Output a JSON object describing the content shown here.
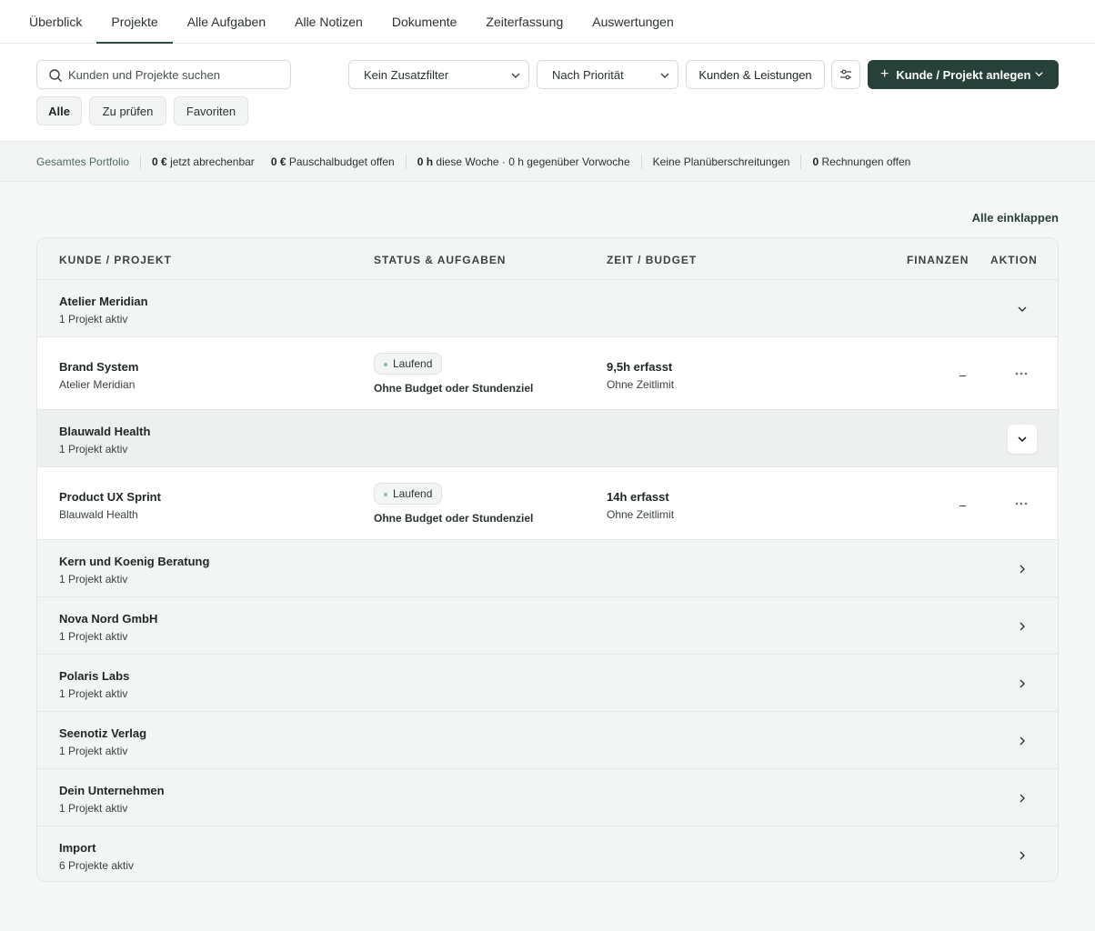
{
  "nav": {
    "tabs": [
      "Überblick",
      "Projekte",
      "Alle Aufgaben",
      "Alle Notizen",
      "Dokumente",
      "Zeiterfassung",
      "Auswertungen"
    ],
    "active": "Projekte"
  },
  "toolbar": {
    "search_placeholder": "Kunden und Projekte suchen",
    "filter_select": "Kein Zusatzfilter",
    "sort_select": "Nach Priorität",
    "clients_button": "Kunden & Leistungen",
    "create_button": "Kunde / Projekt anlegen",
    "chips": [
      "Alle",
      "Zu prüfen",
      "Favoriten"
    ],
    "active_chip": "Alle"
  },
  "summary": {
    "lead": "Gesamtes Portfolio",
    "billable_value": "0 €",
    "billable_label": "jetzt abrechenbar",
    "flat_value": "0 €",
    "flat_label": "Pauschalbudget offen",
    "week_value": "0 h",
    "week_label": "diese Woche · 0 h gegenüber Vorwoche",
    "overruns": "Keine Planüberschreitungen",
    "invoices_value": "0",
    "invoices_label": "Rechnungen offen"
  },
  "collapse_all": "Alle einklappen",
  "table": {
    "headers": {
      "client_project": "KUNDE / PROJEKT",
      "status": "STATUS & AUFGABEN",
      "time": "ZEIT / BUDGET",
      "finance": "FINANZEN",
      "action": "AKTION"
    },
    "rows": [
      {
        "name": "Atelier Meridian",
        "sub": "1 Projekt aktiv"
      },
      {
        "name": "Brand System",
        "sub": "Atelier Meridian",
        "status": "Laufend",
        "budget_note": "Ohne Budget oder Stundenziel",
        "time": "9,5h erfasst",
        "time_sub": "Ohne Zeitlimit",
        "finance": "–"
      },
      {
        "name": "Blauwald Health",
        "sub": "1 Projekt aktiv"
      },
      {
        "name": "Product UX Sprint",
        "sub": "Blauwald Health",
        "status": "Laufend",
        "budget_note": "Ohne Budget oder Stundenziel",
        "time": "14h erfasst",
        "time_sub": "Ohne Zeitlimit",
        "finance": "–"
      },
      {
        "name": "Kern und Koenig Beratung",
        "sub": "1 Projekt aktiv"
      },
      {
        "name": "Nova Nord GmbH",
        "sub": "1 Projekt aktiv"
      },
      {
        "name": "Polaris Labs",
        "sub": "1 Projekt aktiv"
      },
      {
        "name": "Seenotiz Verlag",
        "sub": "1 Projekt aktiv"
      },
      {
        "name": "Dein Unternehmen",
        "sub": "1 Projekt aktiv"
      },
      {
        "name": "Import",
        "sub": "6 Projekte aktiv"
      }
    ]
  },
  "colors": {
    "primary": "#27403a",
    "status_dot": "#8fb3a5"
  }
}
